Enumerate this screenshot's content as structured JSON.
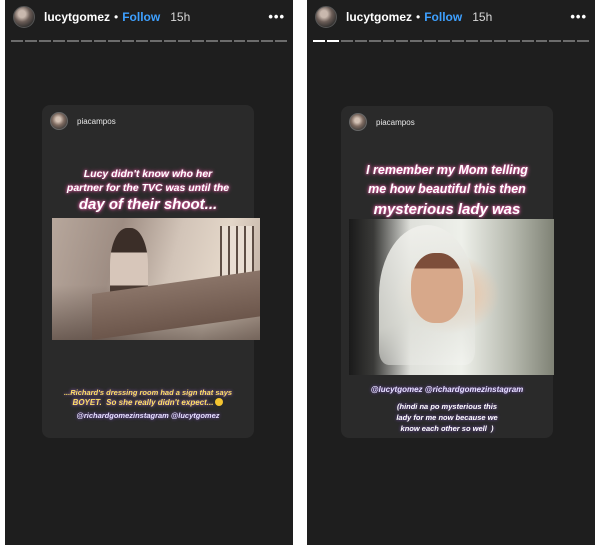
{
  "panels": [
    {
      "header": {
        "username": "lucytgomez",
        "separator": "•",
        "follow_label": "Follow",
        "time_ago": "15h",
        "more_label": "•••"
      },
      "progress": {
        "segments_total": 20,
        "segments_viewed": 0
      },
      "card": {
        "username": "piacampos",
        "headline_lines": [
          "Lucy didn't know who her",
          "partner for the TVC was until the"
        ],
        "headline_big": "day of their shoot...",
        "caption_lines": [
          "...Richard's dressing room had a sign that says",
          "BOYET.  So she really didn't expect..."
        ],
        "tags": "@richardgomezinstagram @lucytgomez"
      }
    },
    {
      "header": {
        "username": "lucytgomez",
        "separator": "•",
        "follow_label": "Follow",
        "time_ago": "15h",
        "more_label": "•••"
      },
      "progress": {
        "segments_total": 20,
        "segments_viewed": 2
      },
      "card": {
        "username": "piacampos",
        "headline_lines": [
          "I remember my Mom telling",
          "me how beautiful this then"
        ],
        "headline_big": "mysterious lady was",
        "tags": "@lucytgomez @richardgomezinstagram",
        "caption_lines": [
          "(hindi na po mysterious this",
          "lady for me now because we",
          "know each other so well  )"
        ]
      }
    }
  ],
  "colors": {
    "story_bg": "#1e1e1e",
    "card_bg": "#2a2a2a",
    "follow": "#3ea0ff",
    "headline_glow": "#e35aa2",
    "caption_highlight": "#ffdf66"
  }
}
